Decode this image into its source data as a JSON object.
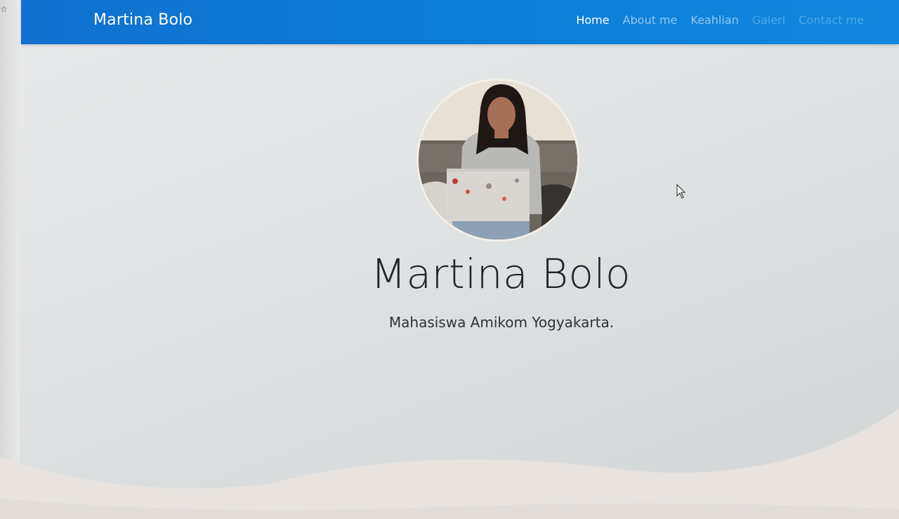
{
  "navbar": {
    "brand": "Martina Bolo",
    "links": [
      "Home",
      "About me",
      "Keahlian",
      "Galeri",
      "Contact me"
    ],
    "active": "Home",
    "color": "#0c7fd8"
  },
  "hero": {
    "name": "Martina Bolo",
    "subtitle": "Mahasiswa Amikom Yogyakarta.",
    "avatar_icon": "profile-photo"
  },
  "colors": {
    "background": "#dfe2e3",
    "text": "#1e2328"
  }
}
